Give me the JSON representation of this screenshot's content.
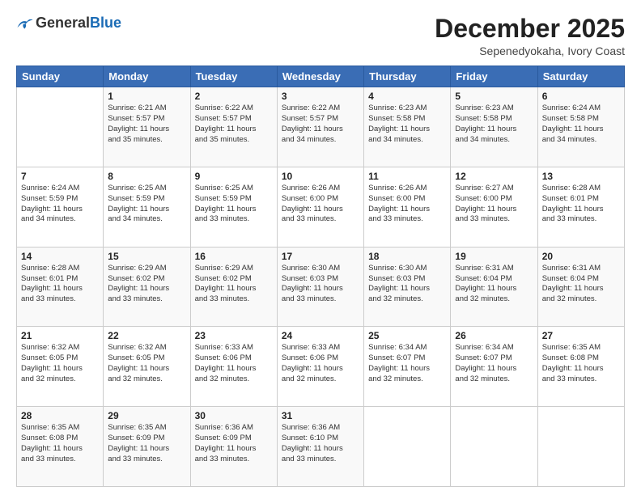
{
  "logo": {
    "general": "General",
    "blue": "Blue"
  },
  "title": "December 2025",
  "subtitle": "Sepenedyokaha, Ivory Coast",
  "days_header": [
    "Sunday",
    "Monday",
    "Tuesday",
    "Wednesday",
    "Thursday",
    "Friday",
    "Saturday"
  ],
  "weeks": [
    [
      {
        "num": "",
        "content": ""
      },
      {
        "num": "1",
        "content": "Sunrise: 6:21 AM\nSunset: 5:57 PM\nDaylight: 11 hours\nand 35 minutes."
      },
      {
        "num": "2",
        "content": "Sunrise: 6:22 AM\nSunset: 5:57 PM\nDaylight: 11 hours\nand 35 minutes."
      },
      {
        "num": "3",
        "content": "Sunrise: 6:22 AM\nSunset: 5:57 PM\nDaylight: 11 hours\nand 34 minutes."
      },
      {
        "num": "4",
        "content": "Sunrise: 6:23 AM\nSunset: 5:58 PM\nDaylight: 11 hours\nand 34 minutes."
      },
      {
        "num": "5",
        "content": "Sunrise: 6:23 AM\nSunset: 5:58 PM\nDaylight: 11 hours\nand 34 minutes."
      },
      {
        "num": "6",
        "content": "Sunrise: 6:24 AM\nSunset: 5:58 PM\nDaylight: 11 hours\nand 34 minutes."
      }
    ],
    [
      {
        "num": "7",
        "content": "Sunrise: 6:24 AM\nSunset: 5:59 PM\nDaylight: 11 hours\nand 34 minutes."
      },
      {
        "num": "8",
        "content": "Sunrise: 6:25 AM\nSunset: 5:59 PM\nDaylight: 11 hours\nand 34 minutes."
      },
      {
        "num": "9",
        "content": "Sunrise: 6:25 AM\nSunset: 5:59 PM\nDaylight: 11 hours\nand 33 minutes."
      },
      {
        "num": "10",
        "content": "Sunrise: 6:26 AM\nSunset: 6:00 PM\nDaylight: 11 hours\nand 33 minutes."
      },
      {
        "num": "11",
        "content": "Sunrise: 6:26 AM\nSunset: 6:00 PM\nDaylight: 11 hours\nand 33 minutes."
      },
      {
        "num": "12",
        "content": "Sunrise: 6:27 AM\nSunset: 6:00 PM\nDaylight: 11 hours\nand 33 minutes."
      },
      {
        "num": "13",
        "content": "Sunrise: 6:28 AM\nSunset: 6:01 PM\nDaylight: 11 hours\nand 33 minutes."
      }
    ],
    [
      {
        "num": "14",
        "content": "Sunrise: 6:28 AM\nSunset: 6:01 PM\nDaylight: 11 hours\nand 33 minutes."
      },
      {
        "num": "15",
        "content": "Sunrise: 6:29 AM\nSunset: 6:02 PM\nDaylight: 11 hours\nand 33 minutes."
      },
      {
        "num": "16",
        "content": "Sunrise: 6:29 AM\nSunset: 6:02 PM\nDaylight: 11 hours\nand 33 minutes."
      },
      {
        "num": "17",
        "content": "Sunrise: 6:30 AM\nSunset: 6:03 PM\nDaylight: 11 hours\nand 33 minutes."
      },
      {
        "num": "18",
        "content": "Sunrise: 6:30 AM\nSunset: 6:03 PM\nDaylight: 11 hours\nand 32 minutes."
      },
      {
        "num": "19",
        "content": "Sunrise: 6:31 AM\nSunset: 6:04 PM\nDaylight: 11 hours\nand 32 minutes."
      },
      {
        "num": "20",
        "content": "Sunrise: 6:31 AM\nSunset: 6:04 PM\nDaylight: 11 hours\nand 32 minutes."
      }
    ],
    [
      {
        "num": "21",
        "content": "Sunrise: 6:32 AM\nSunset: 6:05 PM\nDaylight: 11 hours\nand 32 minutes."
      },
      {
        "num": "22",
        "content": "Sunrise: 6:32 AM\nSunset: 6:05 PM\nDaylight: 11 hours\nand 32 minutes."
      },
      {
        "num": "23",
        "content": "Sunrise: 6:33 AM\nSunset: 6:06 PM\nDaylight: 11 hours\nand 32 minutes."
      },
      {
        "num": "24",
        "content": "Sunrise: 6:33 AM\nSunset: 6:06 PM\nDaylight: 11 hours\nand 32 minutes."
      },
      {
        "num": "25",
        "content": "Sunrise: 6:34 AM\nSunset: 6:07 PM\nDaylight: 11 hours\nand 32 minutes."
      },
      {
        "num": "26",
        "content": "Sunrise: 6:34 AM\nSunset: 6:07 PM\nDaylight: 11 hours\nand 32 minutes."
      },
      {
        "num": "27",
        "content": "Sunrise: 6:35 AM\nSunset: 6:08 PM\nDaylight: 11 hours\nand 33 minutes."
      }
    ],
    [
      {
        "num": "28",
        "content": "Sunrise: 6:35 AM\nSunset: 6:08 PM\nDaylight: 11 hours\nand 33 minutes."
      },
      {
        "num": "29",
        "content": "Sunrise: 6:35 AM\nSunset: 6:09 PM\nDaylight: 11 hours\nand 33 minutes."
      },
      {
        "num": "30",
        "content": "Sunrise: 6:36 AM\nSunset: 6:09 PM\nDaylight: 11 hours\nand 33 minutes."
      },
      {
        "num": "31",
        "content": "Sunrise: 6:36 AM\nSunset: 6:10 PM\nDaylight: 11 hours\nand 33 minutes."
      },
      {
        "num": "",
        "content": ""
      },
      {
        "num": "",
        "content": ""
      },
      {
        "num": "",
        "content": ""
      }
    ]
  ]
}
